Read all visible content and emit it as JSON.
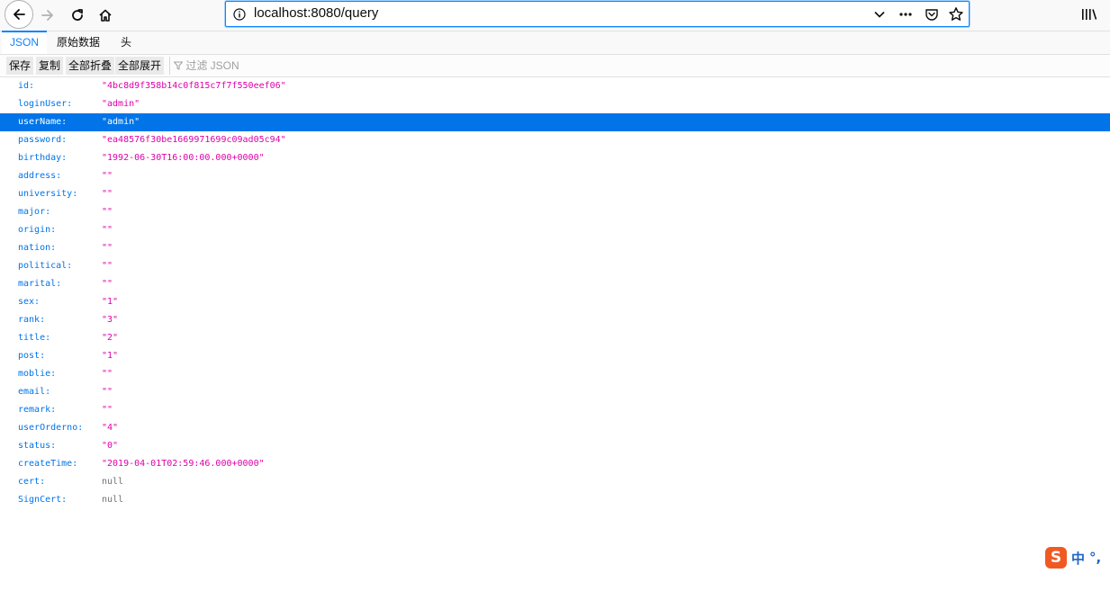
{
  "browser": {
    "url": "localhost:8080/query",
    "icons": [
      "back-arrow-icon",
      "forward-arrow-icon",
      "reload-icon",
      "home-icon",
      "info-icon",
      "chevron-down-icon",
      "more-icon",
      "pocket-icon",
      "star-icon",
      "library-icon"
    ]
  },
  "viewer": {
    "tabs": [
      "JSON",
      "原始数据",
      "头"
    ],
    "active_tab": "JSON",
    "toolbar": {
      "save": "保存",
      "copy": "复制",
      "collapse_all": "全部折叠",
      "expand_all": "全部展开",
      "filter_placeholder": "过滤 JSON"
    }
  },
  "json_rows": [
    {
      "key": "id:",
      "value": "\"4bc8d9f358b14c0f815c7f7f550eef06\""
    },
    {
      "key": "loginUser:",
      "value": "\"admin\""
    },
    {
      "key": "userName:",
      "value": "\"admin\""
    },
    {
      "key": "password:",
      "value": "\"ea48576f30be1669971699c09ad05c94\""
    },
    {
      "key": "birthday:",
      "value": "\"1992-06-30T16:00:00.000+0000\""
    },
    {
      "key": "address:",
      "value": "\"\""
    },
    {
      "key": "university:",
      "value": "\"\""
    },
    {
      "key": "major:",
      "value": "\"\""
    },
    {
      "key": "origin:",
      "value": "\"\""
    },
    {
      "key": "nation:",
      "value": "\"\""
    },
    {
      "key": "political:",
      "value": "\"\""
    },
    {
      "key": "marital:",
      "value": "\"\""
    },
    {
      "key": "sex:",
      "value": "\"1\""
    },
    {
      "key": "rank:",
      "value": "\"3\""
    },
    {
      "key": "title:",
      "value": "\"2\""
    },
    {
      "key": "post:",
      "value": "\"1\""
    },
    {
      "key": "moblie:",
      "value": "\"\""
    },
    {
      "key": "email:",
      "value": "\"\""
    },
    {
      "key": "remark:",
      "value": "\"\""
    },
    {
      "key": "userOrderno:",
      "value": "\"4\""
    },
    {
      "key": "status:",
      "value": "\"0\""
    },
    {
      "key": "createTime:",
      "value": "\"2019-04-01T02:59:46.000+0000\""
    },
    {
      "key": "cert:",
      "value": "null"
    },
    {
      "key": "SignCert:",
      "value": "null"
    }
  ],
  "selected_row_key": "userName:",
  "ime": {
    "logo": "S",
    "lang": "中",
    "punct": "°,"
  },
  "colors": {
    "accent": "#0a84ff",
    "selected_row": "#0074e8",
    "key": "#0074e8",
    "string_value": "#dd00a9",
    "null_value": "#737373"
  }
}
